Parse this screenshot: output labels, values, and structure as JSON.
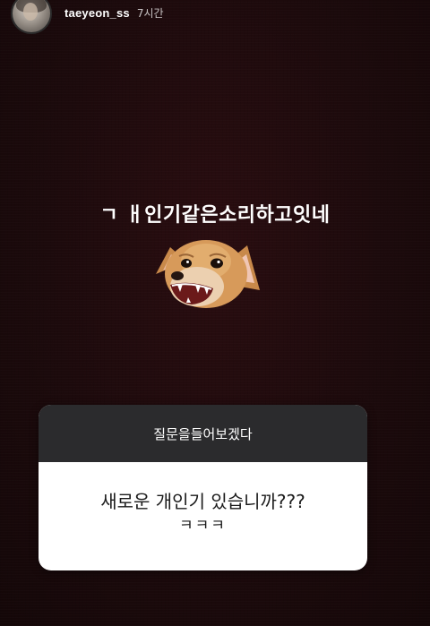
{
  "header": {
    "username": "taeyeon_ss",
    "time": "7시간"
  },
  "caption": {
    "text": "ㄱ ㅐ인기같은소리하고잇네"
  },
  "sticker": {
    "icon": "angry-chihuahua-sticker"
  },
  "question_card": {
    "title": "질문을들어보겠다",
    "question": "새로운 개인기 있습니까???",
    "sub": "ㅋㅋㅋ"
  },
  "colors": {
    "background": "#1c0a0c",
    "card_header": "#2b2b2d",
    "card_body": "#ffffff"
  }
}
